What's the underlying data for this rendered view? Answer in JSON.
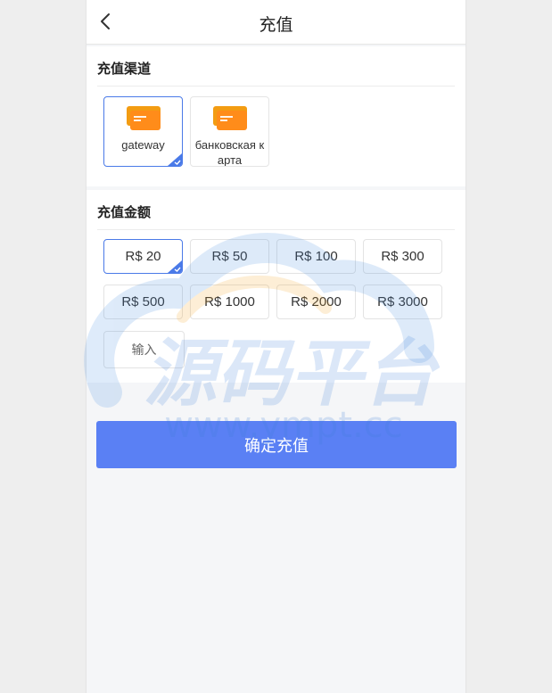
{
  "header": {
    "title": "充值"
  },
  "channels": {
    "title": "充值渠道",
    "items": [
      {
        "label": "gateway",
        "icon": "credit-card-icon",
        "selected": true
      },
      {
        "label": "банковская карта",
        "icon": "credit-card-icon",
        "selected": false
      }
    ]
  },
  "amounts": {
    "title": "充值金额",
    "items": [
      {
        "label": "R$ 20",
        "selected": true
      },
      {
        "label": "R$ 50",
        "selected": false
      },
      {
        "label": "R$ 100",
        "selected": false
      },
      {
        "label": "R$ 300",
        "selected": false
      },
      {
        "label": "R$ 500",
        "selected": false
      },
      {
        "label": "R$ 1000",
        "selected": false
      },
      {
        "label": "R$ 2000",
        "selected": false
      },
      {
        "label": "R$ 3000",
        "selected": false
      }
    ],
    "input_placeholder": "输入",
    "input_value": ""
  },
  "confirm_label": "确定充值",
  "watermark": {
    "text": "源码平台",
    "url": "www.ympt.cc"
  },
  "colors": {
    "accent": "#5a80f4",
    "selected_border": "#4a7ae8",
    "icon_orange": "#f7931e"
  }
}
